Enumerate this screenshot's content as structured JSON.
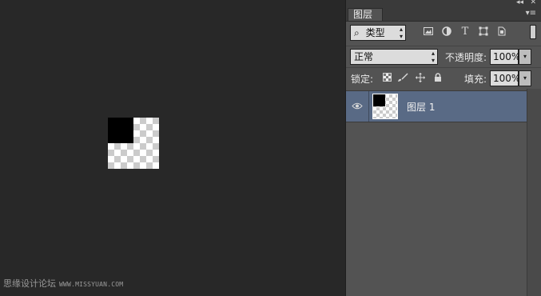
{
  "panel": {
    "tab_label": "图层",
    "collapse_icon": "◂◂",
    "close_icon": "✕",
    "menu_icon": "▾≡"
  },
  "filter": {
    "kind_label": "类型",
    "search_icon": "⌕",
    "icons": [
      "image-filter-icon",
      "adjustment-filter-icon",
      "text-filter-icon",
      "shape-filter-icon",
      "smart-object-filter-icon"
    ]
  },
  "blend": {
    "mode": "正常",
    "opacity_label": "不透明度:",
    "opacity_value": "100%"
  },
  "lock": {
    "label": "锁定:",
    "fill_label": "填充:",
    "fill_value": "100%"
  },
  "layers": [
    {
      "name": "图层 1",
      "visible": true,
      "selected": true
    }
  ],
  "watermark": {
    "text": "思缘设计论坛",
    "url": "WWW.MISSYUAN.COM"
  }
}
